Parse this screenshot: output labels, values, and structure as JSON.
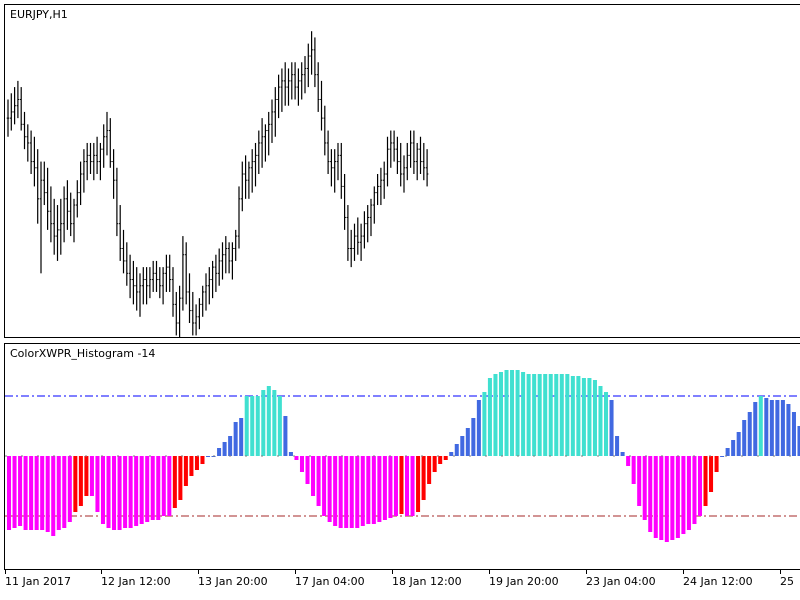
{
  "chart_data": [
    {
      "type": "line",
      "title": "EURJPY,H1",
      "style": "bars",
      "color": "#000000",
      "ylim": [
        119.0,
        123.8
      ],
      "ohlc": [
        [
          122.3,
          122.6,
          122.0,
          122.3
        ],
        [
          122.3,
          122.7,
          122.1,
          122.4
        ],
        [
          122.4,
          122.8,
          122.2,
          122.5
        ],
        [
          122.5,
          122.9,
          122.3,
          122.6
        ],
        [
          122.6,
          122.8,
          122.1,
          122.2
        ],
        [
          122.2,
          122.4,
          121.8,
          122.0
        ],
        [
          122.0,
          122.2,
          121.6,
          121.9
        ],
        [
          121.9,
          122.1,
          121.4,
          121.6
        ],
        [
          121.6,
          122.0,
          121.2,
          121.5
        ],
        [
          121.5,
          121.8,
          120.6,
          121.0
        ],
        [
          121.0,
          121.6,
          119.8,
          121.3
        ],
        [
          121.3,
          121.6,
          120.9,
          121.1
        ],
        [
          121.1,
          121.5,
          120.5,
          120.8
        ],
        [
          120.8,
          121.2,
          120.3,
          120.6
        ],
        [
          120.6,
          121.0,
          120.1,
          120.4
        ],
        [
          120.4,
          120.9,
          120.0,
          120.5
        ],
        [
          120.5,
          121.0,
          120.1,
          120.6
        ],
        [
          120.6,
          121.2,
          120.3,
          121.0
        ],
        [
          121.0,
          121.3,
          120.5,
          120.8
        ],
        [
          120.8,
          121.1,
          120.4,
          120.6
        ],
        [
          120.6,
          121.0,
          120.3,
          120.9
        ],
        [
          120.9,
          121.3,
          120.7,
          121.1
        ],
        [
          121.1,
          121.6,
          120.9,
          121.4
        ],
        [
          121.4,
          121.8,
          121.1,
          121.6
        ],
        [
          121.6,
          121.9,
          121.3,
          121.7
        ],
        [
          121.7,
          121.9,
          121.4,
          121.6
        ],
        [
          121.6,
          121.9,
          121.3,
          121.7
        ],
        [
          121.7,
          122.0,
          121.4,
          121.6
        ],
        [
          121.6,
          121.9,
          121.3,
          121.8
        ],
        [
          121.8,
          122.2,
          121.5,
          122.0
        ],
        [
          122.0,
          122.4,
          121.7,
          122.1
        ],
        [
          122.1,
          122.3,
          121.5,
          121.6
        ],
        [
          121.6,
          121.8,
          121.0,
          121.3
        ],
        [
          121.3,
          121.5,
          120.4,
          120.6
        ],
        [
          120.6,
          120.9,
          120.0,
          120.2
        ],
        [
          120.2,
          120.5,
          119.8,
          120.0
        ],
        [
          120.0,
          120.3,
          119.6,
          119.8
        ],
        [
          119.8,
          120.1,
          119.4,
          119.7
        ],
        [
          119.7,
          120.0,
          119.3,
          119.6
        ],
        [
          119.6,
          119.9,
          119.2,
          119.5
        ],
        [
          119.5,
          119.8,
          119.1,
          119.6
        ],
        [
          119.6,
          119.9,
          119.3,
          119.7
        ],
        [
          119.7,
          119.9,
          119.3,
          119.6
        ],
        [
          119.6,
          119.9,
          119.4,
          119.7
        ],
        [
          119.7,
          120.0,
          119.5,
          119.8
        ],
        [
          119.8,
          120.0,
          119.5,
          119.7
        ],
        [
          119.7,
          119.9,
          119.4,
          119.6
        ],
        [
          119.6,
          119.9,
          119.3,
          119.8
        ],
        [
          119.8,
          120.1,
          119.5,
          119.9
        ],
        [
          119.9,
          120.1,
          119.5,
          119.7
        ],
        [
          119.7,
          119.9,
          119.1,
          119.3
        ],
        [
          119.3,
          119.5,
          118.8,
          119.0
        ],
        [
          119.0,
          119.6,
          118.7,
          119.4
        ],
        [
          119.4,
          120.4,
          119.2,
          120.1
        ],
        [
          120.1,
          120.3,
          119.3,
          119.5
        ],
        [
          119.5,
          119.8,
          119.0,
          119.2
        ],
        [
          119.2,
          119.5,
          118.8,
          119.0
        ],
        [
          119.0,
          119.3,
          118.8,
          119.1
        ],
        [
          119.1,
          119.4,
          118.9,
          119.3
        ],
        [
          119.3,
          119.6,
          119.1,
          119.5
        ],
        [
          119.5,
          119.8,
          119.2,
          119.6
        ],
        [
          119.6,
          119.9,
          119.3,
          119.7
        ],
        [
          119.7,
          120.0,
          119.4,
          119.9
        ],
        [
          119.9,
          120.1,
          119.5,
          119.8
        ],
        [
          119.8,
          120.2,
          119.6,
          120.0
        ],
        [
          120.0,
          120.3,
          119.7,
          120.1
        ],
        [
          120.1,
          120.4,
          119.8,
          120.2
        ],
        [
          120.2,
          120.3,
          119.8,
          120.0
        ],
        [
          120.0,
          120.3,
          119.7,
          120.2
        ],
        [
          120.2,
          120.5,
          120.0,
          120.4
        ],
        [
          120.4,
          121.2,
          120.2,
          121.0
        ],
        [
          121.0,
          121.6,
          120.8,
          121.4
        ],
        [
          121.4,
          121.7,
          121.0,
          121.3
        ],
        [
          121.3,
          121.6,
          121.0,
          121.5
        ],
        [
          121.5,
          121.8,
          121.1,
          121.6
        ],
        [
          121.6,
          121.9,
          121.2,
          121.7
        ],
        [
          121.7,
          122.1,
          121.4,
          121.9
        ],
        [
          121.9,
          122.3,
          121.5,
          122.0
        ],
        [
          122.0,
          122.2,
          121.6,
          122.1
        ],
        [
          122.1,
          122.4,
          121.7,
          122.2
        ],
        [
          122.2,
          122.6,
          121.9,
          122.4
        ],
        [
          122.4,
          122.8,
          122.0,
          122.6
        ],
        [
          122.6,
          123.0,
          122.3,
          122.8
        ],
        [
          122.8,
          123.1,
          122.4,
          122.9
        ],
        [
          122.9,
          123.2,
          122.5,
          122.8
        ],
        [
          122.8,
          123.1,
          122.5,
          122.9
        ],
        [
          122.9,
          123.2,
          122.6,
          123.0
        ],
        [
          123.0,
          123.2,
          122.6,
          122.8
        ],
        [
          122.8,
          123.1,
          122.5,
          122.9
        ],
        [
          122.9,
          123.2,
          122.6,
          123.0
        ],
        [
          123.0,
          123.3,
          122.7,
          123.1
        ],
        [
          123.1,
          123.5,
          122.8,
          123.3
        ],
        [
          123.3,
          123.7,
          123.0,
          123.4
        ],
        [
          123.4,
          123.6,
          122.8,
          123.0
        ],
        [
          123.0,
          123.2,
          122.4,
          122.6
        ],
        [
          122.6,
          122.9,
          122.1,
          122.3
        ],
        [
          122.3,
          122.5,
          121.7,
          121.9
        ],
        [
          121.9,
          122.1,
          121.4,
          121.6
        ],
        [
          121.6,
          121.8,
          121.2,
          121.5
        ],
        [
          121.5,
          121.8,
          121.1,
          121.6
        ],
        [
          121.6,
          121.9,
          121.3,
          121.7
        ],
        [
          121.7,
          121.9,
          121.0,
          121.2
        ],
        [
          121.2,
          121.4,
          120.5,
          120.7
        ],
        [
          120.7,
          120.9,
          120.0,
          120.2
        ],
        [
          120.2,
          120.5,
          119.9,
          120.2
        ],
        [
          120.2,
          120.6,
          120.0,
          120.4
        ],
        [
          120.4,
          120.7,
          120.1,
          120.3
        ],
        [
          120.3,
          120.6,
          120.0,
          120.4
        ],
        [
          120.4,
          120.8,
          120.2,
          120.6
        ],
        [
          120.6,
          120.9,
          120.3,
          120.7
        ],
        [
          120.7,
          121.0,
          120.4,
          120.9
        ],
        [
          120.9,
          121.2,
          120.6,
          121.1
        ],
        [
          121.1,
          121.4,
          120.9,
          121.2
        ],
        [
          121.2,
          121.5,
          120.9,
          121.3
        ],
        [
          121.3,
          121.6,
          121.0,
          121.4
        ],
        [
          121.4,
          122.0,
          121.2,
          121.8
        ],
        [
          121.8,
          122.1,
          121.5,
          121.9
        ],
        [
          121.9,
          122.1,
          121.6,
          121.8
        ],
        [
          121.8,
          122.0,
          121.4,
          121.6
        ],
        [
          121.6,
          121.9,
          121.2,
          121.4
        ],
        [
          121.4,
          121.7,
          121.1,
          121.5
        ],
        [
          121.5,
          121.9,
          121.3,
          121.7
        ],
        [
          121.7,
          122.1,
          121.5,
          121.9
        ],
        [
          121.9,
          122.1,
          121.4,
          121.6
        ],
        [
          121.6,
          121.9,
          121.3,
          121.8
        ],
        [
          121.8,
          122.0,
          121.4,
          121.6
        ],
        [
          121.6,
          121.9,
          121.3,
          121.5
        ],
        [
          121.5,
          121.8,
          121.2,
          121.4
        ]
      ]
    },
    {
      "type": "bar",
      "title": "ColorXWPR_Histogram -14",
      "ylim": [
        -100,
        0
      ],
      "levels": [
        {
          "value": -20,
          "color": "#0000ff",
          "style": "dash-dot"
        },
        {
          "value": -80,
          "color": "#a52a2a",
          "style": "dash-dot"
        }
      ],
      "midline": -50,
      "colors": {
        "strong_up": "#40e0d0",
        "up": "#4169e1",
        "down": "#ff0000",
        "strong_down": "#ff00ff",
        "midline": "#808080"
      },
      "values": [
        -87,
        -86,
        -85,
        -87,
        -87,
        -87,
        -87,
        -88,
        -90,
        -87,
        -86,
        -83,
        -78,
        -75,
        -70,
        -70,
        -78,
        -84,
        -86,
        -87,
        -87,
        -86,
        -86,
        -85,
        -84,
        -83,
        -82,
        -82,
        -80,
        -80,
        -76,
        -72,
        -65,
        -60,
        -57,
        -54,
        -50,
        -50,
        -46,
        -43,
        -40,
        -33,
        -31,
        -20,
        -20,
        -20,
        -17,
        -15,
        -17,
        -20,
        -30,
        -48,
        -52,
        -58,
        -64,
        -70,
        -75,
        -80,
        -83,
        -85,
        -86,
        -86,
        -86,
        -86,
        -85,
        -84,
        -84,
        -83,
        -82,
        -81,
        -80,
        -79,
        -80,
        -80,
        -78,
        -72,
        -64,
        -58,
        -54,
        -52,
        -48,
        -44,
        -40,
        -36,
        -31,
        -22,
        -18,
        -11,
        -9,
        -8,
        -7,
        -7,
        -7,
        -8,
        -9,
        -9,
        -9,
        -9,
        -9,
        -9,
        -9,
        -9,
        -10,
        -10,
        -11,
        -11,
        -12,
        -15,
        -18,
        -22,
        -40,
        -48,
        -55,
        -64,
        -75,
        -82,
        -88,
        -91,
        -92,
        -93,
        -92,
        -91,
        -89,
        -87,
        -84,
        -80,
        -75,
        -68,
        -58,
        -50,
        -46,
        -42,
        -38,
        -32,
        -28,
        -23,
        -20,
        -21,
        -22,
        -22,
        -22,
        -24,
        -28,
        -35
      ]
    }
  ],
  "time_axis": {
    "labels": [
      "11 Jan 2017",
      "12 Jan 12:00",
      "13 Jan 20:00",
      "17 Jan 04:00",
      "18 Jan 12:00",
      "19 Jan 20:00",
      "23 Jan 04:00",
      "24 Jan 12:00",
      "25"
    ]
  }
}
